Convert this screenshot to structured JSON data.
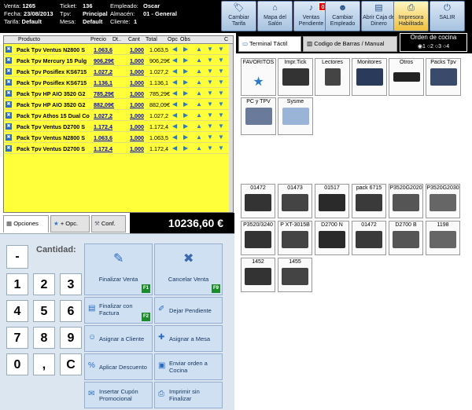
{
  "header": {
    "venta_label": "Venta:",
    "venta": "1265",
    "fecha_label": "Fecha:",
    "fecha": "23/08/2013",
    "tarifa_label": "Tarifa:",
    "tarifa": "Default",
    "ticket_label": "Ticket:",
    "ticket": "136",
    "tpv_label": "Tpv:",
    "tpv": "Principal",
    "mesa_label": "Mesa:",
    "mesa": "Default",
    "empleado_label": "Empleado:",
    "empleado": "Oscar",
    "almacen_label": "Almacén:",
    "almacen": "01 - General",
    "cliente_label": "Cliente:",
    "cliente": "1"
  },
  "toolbar": [
    {
      "label": "Cambiar Tarifa",
      "icon": "tag-icon"
    },
    {
      "label": "Mapa del Salón",
      "icon": "home-icon"
    },
    {
      "label": "Ventas Pendiente",
      "icon": "bell-icon",
      "badge": "0"
    },
    {
      "label": "Cambiar Empleado",
      "icon": "user-icon"
    },
    {
      "label": "Abrir Caja de Dinero",
      "icon": "cash-icon"
    },
    {
      "label": "Impresora Habilitada",
      "icon": "printer-icon"
    },
    {
      "label": "SALIR",
      "icon": "exit-icon"
    }
  ],
  "table": {
    "headers": [
      "Producto",
      "Precio",
      "Dt..",
      "Cant",
      "Total",
      "Opc",
      "Obs",
      "C"
    ],
    "rows": [
      {
        "name": "Pack Tpv Ventus N2800 S",
        "price": "1.063,6",
        "qty": "1,000",
        "total": "1.063,5"
      },
      {
        "name": "Pack Tpv Mercury 15 Pulg",
        "price": "906,29€",
        "qty": "1,000",
        "total": "906,29€"
      },
      {
        "name": "Pack Tpv Posiflex KS6715",
        "price": "1.027,2",
        "qty": "1,000",
        "total": "1.027,2"
      },
      {
        "name": "Pack Tpv Posiflex KS6715",
        "price": "1.136,1",
        "qty": "1,000",
        "total": "1.136,1"
      },
      {
        "name": "Pack Tpv HP AIO 3520 G2",
        "price": "785,29€",
        "qty": "1,000",
        "total": "785,29€"
      },
      {
        "name": "Pack Tpv HP AIO 3520 G2",
        "price": "882,09€",
        "qty": "1,000",
        "total": "882,09€"
      },
      {
        "name": "Pack Tpv Athos 15 Dual Co",
        "price": "1.027,2",
        "qty": "1,000",
        "total": "1.027,2"
      },
      {
        "name": "Pack Tpv Ventus D2700 S",
        "price": "1.172,4",
        "qty": "1,000",
        "total": "1.172,4"
      },
      {
        "name": "Pack Tpv Ventus N2800 S",
        "price": "1.063,6",
        "qty": "1,000",
        "total": "1.063,5"
      },
      {
        "name": "Pack Tpv Ventus D2700 S",
        "price": "1.172,4",
        "qty": "1,000",
        "total": "1.172,4"
      }
    ]
  },
  "left_tabs": [
    "Opciones",
    "+ Opc.",
    "Conf."
  ],
  "total": "10236,60 €",
  "cantidad_label": "Cantidad:",
  "keys": [
    "-",
    "1",
    "2",
    "3",
    "4",
    "5",
    "6",
    "7",
    "8",
    "9",
    "0",
    ",",
    "C"
  ],
  "actions": [
    {
      "label": "Finalizar Venta",
      "fk": "F1"
    },
    {
      "label": "Cancelar Venta",
      "fk": "F9"
    },
    {
      "label": "Finalizar con Factura",
      "fk": "F2"
    },
    {
      "label": "Dejar Pendiente",
      "fk": ""
    },
    {
      "label": "Asignar a Cliente",
      "fk": ""
    },
    {
      "label": "Asignar a Mesa",
      "fk": ""
    },
    {
      "label": "Aplicar Descuento",
      "fk": ""
    },
    {
      "label": "Enviar orden a Cocina",
      "fk": ""
    },
    {
      "label": "Insertar Cupón Promocional",
      "fk": ""
    },
    {
      "label": "Imprimir sin Finalizar",
      "fk": ""
    }
  ],
  "right_tabs": [
    "Terminal Táctil",
    "Codigo de Barras / Manual"
  ],
  "orden": {
    "title": "Orden de cocina",
    "options": [
      "1",
      "2",
      "3",
      "4"
    ],
    "selected": "3"
  },
  "categories": [
    "FAVORITOS",
    "Impr.Tick",
    "Lectores",
    "Monitores",
    "Otros",
    "Packs Tpv",
    "PC y TPV",
    "Sysme"
  ],
  "products": [
    "01472",
    "01473",
    "01517",
    "pack 6715",
    "P3520G2020",
    "P3520G2030",
    "P3520/3240",
    "P XT-3015B",
    "D2700 N",
    "01472",
    "D2700 B",
    "1198",
    "1452",
    "1455"
  ]
}
